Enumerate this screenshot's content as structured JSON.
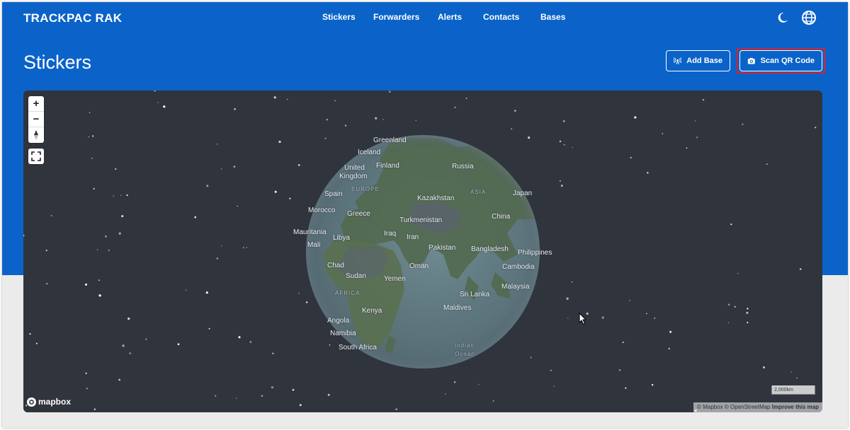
{
  "app": {
    "brand": "TRACKPAC RAK"
  },
  "nav": {
    "items": [
      {
        "label": "Stickers"
      },
      {
        "label": "Forwarders"
      },
      {
        "label": "Alerts"
      },
      {
        "label": "Contacts"
      },
      {
        "label": "Bases"
      }
    ]
  },
  "header_icons": [
    "moon-icon",
    "globe-language-icon"
  ],
  "page": {
    "title": "Stickers",
    "add_base_label": "Add Base",
    "scan_qr_label": "Scan QR Code"
  },
  "map": {
    "controls": {
      "zoom_in": "+",
      "zoom_out": "−"
    },
    "labels": {
      "greenland": "Greenland",
      "iceland": "Iceland",
      "united_kingdom_1": "United",
      "united_kingdom_2": "Kingdom",
      "finland": "Finland",
      "russia": "Russia",
      "europe": "EUROPE",
      "asia": "ASIA",
      "spain": "Spain",
      "kazakhstan": "Kazakhstan",
      "japan": "Japan",
      "morocco": "Morocco",
      "greece": "Greece",
      "turkmenistan": "Turkmenistan",
      "china": "China",
      "mauritania": "Mauritania",
      "libya": "Libya",
      "iraq": "Iraq",
      "iran": "Iran",
      "mali": "Mali",
      "pakistan": "Pakistan",
      "bangladesh": "Bangladesh",
      "philippines": "Philippines",
      "chad": "Chad",
      "oman": "Oman",
      "cambodia": "Cambodia",
      "sudan": "Sudan",
      "yemen": "Yemen",
      "malaysia": "Malaysia",
      "africa": "AFRICA",
      "sri_lanka": "Sri Lanka",
      "maldives": "Maldives",
      "kenya": "Kenya",
      "angola": "Angola",
      "namibia": "Namibia",
      "indian_ocean_1": "Indian",
      "indian_ocean_2": "Ocean",
      "south_africa": "South Africa"
    },
    "logo_text": "mapbox",
    "scale_label": "2,000km",
    "attribution": "© Mapbox © OpenStreetMap",
    "improve_link": "Improve this map"
  },
  "colors": {
    "header_blue": "#0b63c9",
    "space": "#30343d",
    "highlight_red": "#d9222a"
  }
}
